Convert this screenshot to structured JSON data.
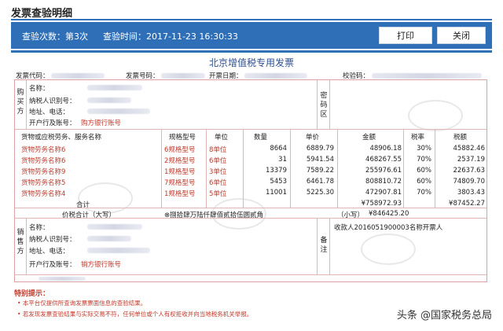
{
  "header": {
    "title": "发票查验明细"
  },
  "toolbar": {
    "check_count": "查验次数：第3次",
    "check_time": "查验时间：2017-11-23 16:30:33",
    "print_label": "打印",
    "close_label": "关闭"
  },
  "invoice": {
    "title": "北京增值税专用发票",
    "code_label": "发票代码：",
    "number_label": "发票号码：",
    "date_label": "开票日期：",
    "check_code_label": "校验码："
  },
  "buyer": {
    "side_label": "购买方",
    "name_label": "名称：",
    "tax_id_label": "纳税人识别号：",
    "address_label": "地址、电话：",
    "bank_label": "开户行及账号：",
    "bank_value": "购方银行账号"
  },
  "cipher_label": "密码区",
  "items": {
    "headers": [
      "货物或应税劳务、服务名称",
      "规格型号",
      "单位",
      "数量",
      "单价",
      "金额",
      "税率",
      "税额"
    ],
    "rows": [
      [
        "货物劳务名称6",
        "6规格型号",
        "8单位",
        "8664",
        "6889.79",
        "48906.18",
        "30%",
        "45882.46"
      ],
      [
        "货物劳务名称6",
        "2规格型号",
        "6单位",
        "31",
        "5941.54",
        "468267.55",
        "70%",
        "2537.19"
      ],
      [
        "货物劳务名称9",
        "1规格型号",
        "3单位",
        "13379",
        "7589.22",
        "255976.61",
        "60%",
        "22637.63"
      ],
      [
        "货物劳务名称5",
        "7规格型号",
        "6单位",
        "5453",
        "6461.78",
        "808810.72",
        "60%",
        "74809.70"
      ],
      [
        "货物劳务名称4",
        "1规格型号",
        "5单位",
        "11001",
        "5225.30",
        "472907.81",
        "70%",
        "3803.43"
      ]
    ],
    "total_label": "合计",
    "total_amount": "¥758972.93",
    "total_tax": "¥87452.27"
  },
  "price_tax_total": {
    "label": "价税合计（大写）",
    "upper": "⊗捌拾肆万陆仟肆佰贰拾伍圆贰角",
    "lower_label": "（小写）",
    "lower": "¥846425.20"
  },
  "seller": {
    "side_label": "销售方",
    "name_label": "名称：",
    "tax_id_label": "纳税人识别号：",
    "address_label": "地址、电话：",
    "bank_label": "开户行及账号：",
    "bank_value": "销方银行账号"
  },
  "remarks": {
    "label": "备注",
    "value": "收款人2016051900003名称开票人"
  },
  "notes": {
    "title": "特别提示：",
    "items": [
      "本平台仅提供所查询发票票面信息的查验结果。",
      "若发现发票查验结果与实际交易不符，任何单位或个人有权拒收并向当地税务机关举报。"
    ]
  },
  "watermark": "头条 @国家税务总局",
  "colors": {
    "toolbar_blue": "#2f6fb7",
    "grid_red": "#d9a3a3",
    "note_red": "#c0392b"
  }
}
